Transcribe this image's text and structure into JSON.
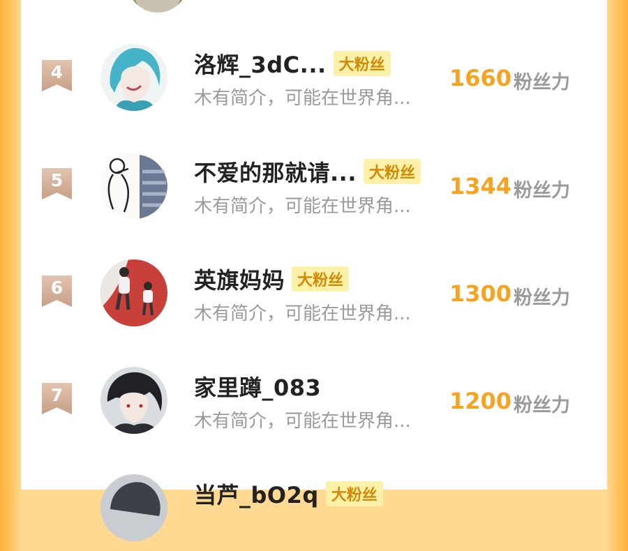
{
  "rows": [
    {
      "rank": "4",
      "name": "洛辉_3dC...",
      "badge": "大粉丝",
      "bio": "木有简介，可能在世界角...",
      "score": "1660",
      "unit": "粉丝力"
    },
    {
      "rank": "5",
      "name": "不爱的那就请...",
      "badge": "大粉丝",
      "bio": "木有简介，可能在世界角...",
      "score": "1344",
      "unit": "粉丝力"
    },
    {
      "rank": "6",
      "name": "英旗妈妈",
      "badge": "大粉丝",
      "bio": "木有简介，可能在世界角...",
      "score": "1300",
      "unit": "粉丝力"
    },
    {
      "rank": "7",
      "name": "家里蹲_083",
      "bio": "木有简介，可能在世界角...",
      "score": "1200",
      "unit": "粉丝力"
    },
    {
      "name": "当芦_bO2q",
      "badge": "大粉丝"
    }
  ]
}
